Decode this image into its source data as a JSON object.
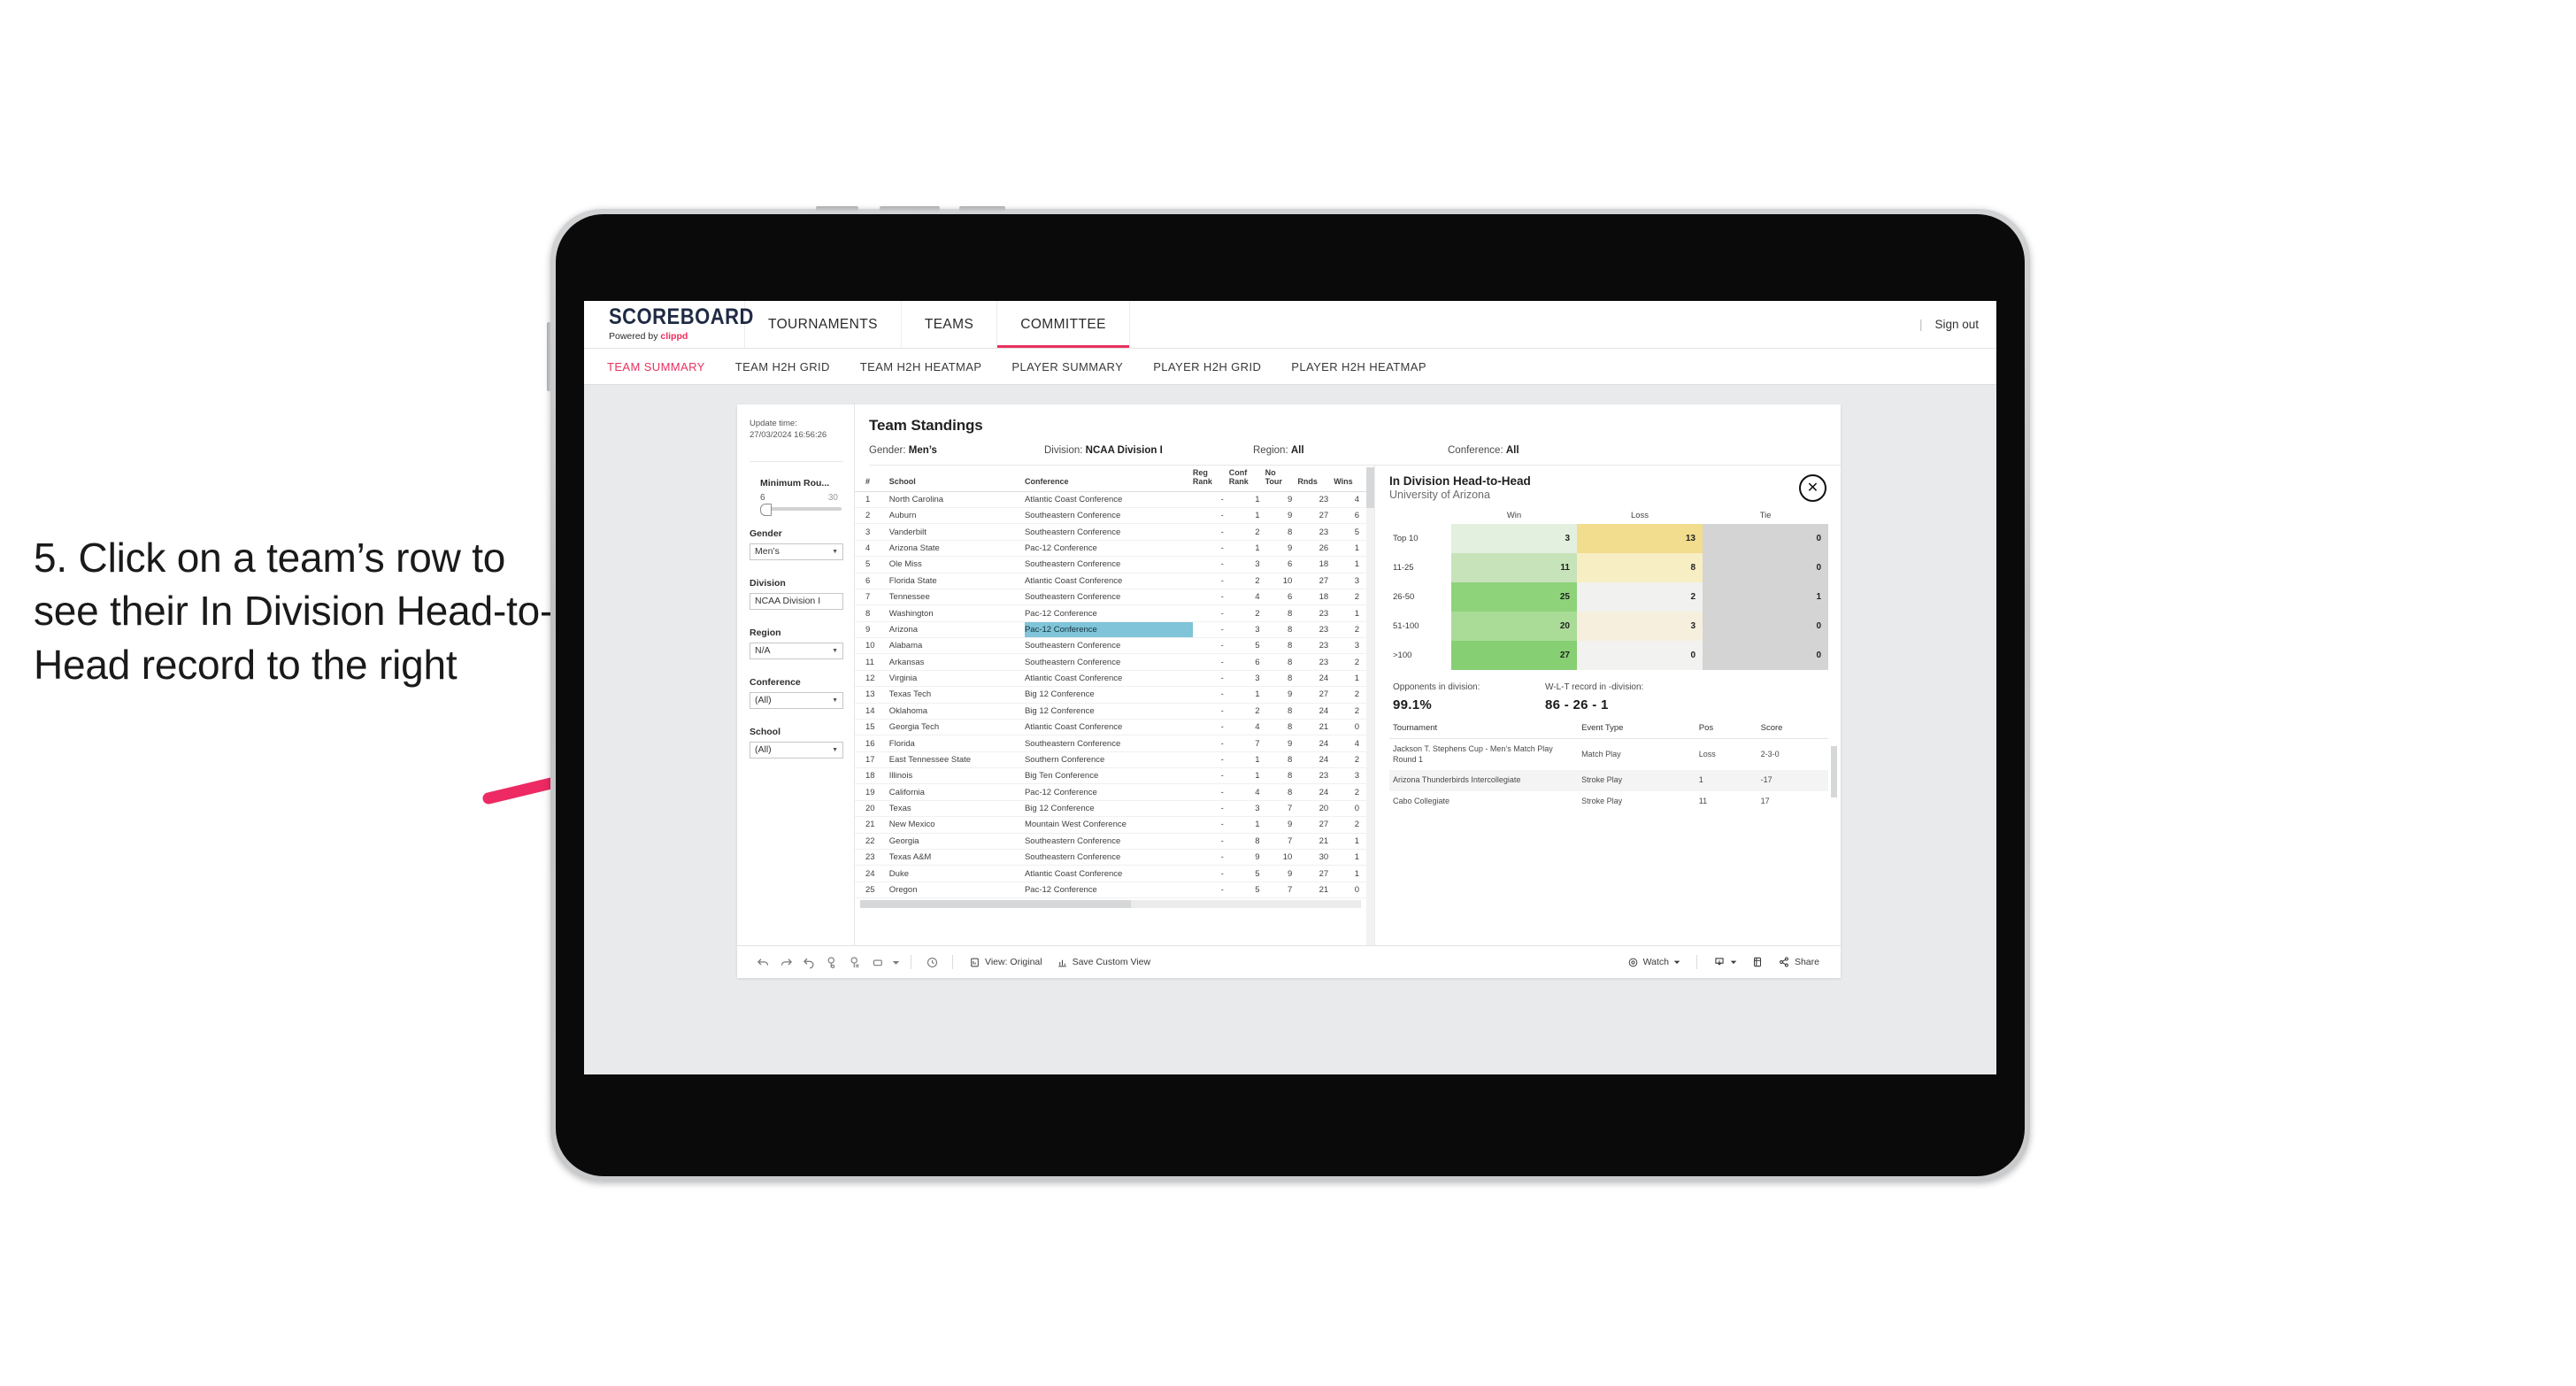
{
  "annotation": {
    "text": "5. Click on a team’s row to see their In Division Head-to-Head record to the right",
    "arrow_color": "#ed2a63"
  },
  "app": {
    "brand": {
      "title": "SCOREBOARD",
      "powered_prefix": "Powered by ",
      "powered_name": "clippd"
    },
    "top_nav": [
      {
        "label": "TOURNAMENTS",
        "active": false
      },
      {
        "label": "TEAMS",
        "active": false
      },
      {
        "label": "COMMITTEE",
        "active": true
      }
    ],
    "sign_out": "Sign out",
    "sub_nav": [
      {
        "label": "TEAM SUMMARY",
        "active": true
      },
      {
        "label": "TEAM H2H GRID",
        "active": false
      },
      {
        "label": "TEAM H2H HEATMAP",
        "active": false
      },
      {
        "label": "PLAYER SUMMARY",
        "active": false
      },
      {
        "label": "PLAYER H2H GRID",
        "active": false
      },
      {
        "label": "PLAYER H2H HEATMAP",
        "active": false
      }
    ]
  },
  "filters": {
    "update_time_label": "Update time:",
    "update_time_value": "27/03/2024 16:56:26",
    "slider": {
      "title": "Minimum Rou...",
      "min": "6",
      "max": "30"
    },
    "gender": {
      "title": "Gender",
      "value": "Men’s"
    },
    "division": {
      "title": "Division",
      "value": "NCAA Division I"
    },
    "region": {
      "title": "Region",
      "value": "N/A"
    },
    "conference": {
      "title": "Conference",
      "value": "(All)"
    },
    "school": {
      "title": "School",
      "value": "(All)"
    }
  },
  "standings": {
    "title": "Team Standings",
    "filter_summary": [
      {
        "label": "Gender:",
        "value": "Men’s"
      },
      {
        "label": "Division:",
        "value": "NCAA Division I"
      },
      {
        "label": "Region:",
        "value": "All"
      },
      {
        "label": "Conference:",
        "value": "All"
      }
    ],
    "columns": [
      "#",
      "School",
      "Conference",
      "Reg Rank",
      "Conf Rank",
      "No Tour",
      "Rnds",
      "Wins"
    ],
    "rows": [
      {
        "n": "1",
        "school": "North Carolina",
        "conf": "Atlantic Coast Conference",
        "reg": "-",
        "cr": "1",
        "nt": "9",
        "rnds": "23",
        "wins": "4"
      },
      {
        "n": "2",
        "school": "Auburn",
        "conf": "Southeastern Conference",
        "reg": "-",
        "cr": "1",
        "nt": "9",
        "rnds": "27",
        "wins": "6"
      },
      {
        "n": "3",
        "school": "Vanderbilt",
        "conf": "Southeastern Conference",
        "reg": "-",
        "cr": "2",
        "nt": "8",
        "rnds": "23",
        "wins": "5"
      },
      {
        "n": "4",
        "school": "Arizona State",
        "conf": "Pac-12 Conference",
        "reg": "-",
        "cr": "1",
        "nt": "9",
        "rnds": "26",
        "wins": "1"
      },
      {
        "n": "5",
        "school": "Ole Miss",
        "conf": "Southeastern Conference",
        "reg": "-",
        "cr": "3",
        "nt": "6",
        "rnds": "18",
        "wins": "1"
      },
      {
        "n": "6",
        "school": "Florida State",
        "conf": "Atlantic Coast Conference",
        "reg": "-",
        "cr": "2",
        "nt": "10",
        "rnds": "27",
        "wins": "3"
      },
      {
        "n": "7",
        "school": "Tennessee",
        "conf": "Southeastern Conference",
        "reg": "-",
        "cr": "4",
        "nt": "6",
        "rnds": "18",
        "wins": "2"
      },
      {
        "n": "8",
        "school": "Washington",
        "conf": "Pac-12 Conference",
        "reg": "-",
        "cr": "2",
        "nt": "8",
        "rnds": "23",
        "wins": "1"
      },
      {
        "n": "9",
        "school": "Arizona",
        "conf": "Pac-12 Conference",
        "reg": "-",
        "cr": "3",
        "nt": "8",
        "rnds": "23",
        "wins": "2",
        "selected": true
      },
      {
        "n": "10",
        "school": "Alabama",
        "conf": "Southeastern Conference",
        "reg": "-",
        "cr": "5",
        "nt": "8",
        "rnds": "23",
        "wins": "3"
      },
      {
        "n": "11",
        "school": "Arkansas",
        "conf": "Southeastern Conference",
        "reg": "-",
        "cr": "6",
        "nt": "8",
        "rnds": "23",
        "wins": "2"
      },
      {
        "n": "12",
        "school": "Virginia",
        "conf": "Atlantic Coast Conference",
        "reg": "-",
        "cr": "3",
        "nt": "8",
        "rnds": "24",
        "wins": "1"
      },
      {
        "n": "13",
        "school": "Texas Tech",
        "conf": "Big 12 Conference",
        "reg": "-",
        "cr": "1",
        "nt": "9",
        "rnds": "27",
        "wins": "2"
      },
      {
        "n": "14",
        "school": "Oklahoma",
        "conf": "Big 12 Conference",
        "reg": "-",
        "cr": "2",
        "nt": "8",
        "rnds": "24",
        "wins": "2"
      },
      {
        "n": "15",
        "school": "Georgia Tech",
        "conf": "Atlantic Coast Conference",
        "reg": "-",
        "cr": "4",
        "nt": "8",
        "rnds": "21",
        "wins": "0"
      },
      {
        "n": "16",
        "school": "Florida",
        "conf": "Southeastern Conference",
        "reg": "-",
        "cr": "7",
        "nt": "9",
        "rnds": "24",
        "wins": "4"
      },
      {
        "n": "17",
        "school": "East Tennessee State",
        "conf": "Southern Conference",
        "reg": "-",
        "cr": "1",
        "nt": "8",
        "rnds": "24",
        "wins": "2"
      },
      {
        "n": "18",
        "school": "Illinois",
        "conf": "Big Ten Conference",
        "reg": "-",
        "cr": "1",
        "nt": "8",
        "rnds": "23",
        "wins": "3"
      },
      {
        "n": "19",
        "school": "California",
        "conf": "Pac-12 Conference",
        "reg": "-",
        "cr": "4",
        "nt": "8",
        "rnds": "24",
        "wins": "2"
      },
      {
        "n": "20",
        "school": "Texas",
        "conf": "Big 12 Conference",
        "reg": "-",
        "cr": "3",
        "nt": "7",
        "rnds": "20",
        "wins": "0"
      },
      {
        "n": "21",
        "school": "New Mexico",
        "conf": "Mountain West Conference",
        "reg": "-",
        "cr": "1",
        "nt": "9",
        "rnds": "27",
        "wins": "2"
      },
      {
        "n": "22",
        "school": "Georgia",
        "conf": "Southeastern Conference",
        "reg": "-",
        "cr": "8",
        "nt": "7",
        "rnds": "21",
        "wins": "1"
      },
      {
        "n": "23",
        "school": "Texas A&M",
        "conf": "Southeastern Conference",
        "reg": "-",
        "cr": "9",
        "nt": "10",
        "rnds": "30",
        "wins": "1"
      },
      {
        "n": "24",
        "school": "Duke",
        "conf": "Atlantic Coast Conference",
        "reg": "-",
        "cr": "5",
        "nt": "9",
        "rnds": "27",
        "wins": "1"
      },
      {
        "n": "25",
        "school": "Oregon",
        "conf": "Pac-12 Conference",
        "reg": "-",
        "cr": "5",
        "nt": "7",
        "rnds": "21",
        "wins": "0"
      }
    ]
  },
  "h2h": {
    "title": "In Division Head-to-Head",
    "subtitle": "University of Arizona",
    "close_icon": "close-icon",
    "columns": [
      "",
      "Win",
      "Loss",
      "Tie"
    ],
    "rows": [
      {
        "label": "Top 10",
        "win": "3",
        "loss": "13",
        "tie": "0",
        "win_color": "#e3efdf",
        "loss_color": "#f2dd8e",
        "tie_color": "#d4d4d4"
      },
      {
        "label": "11-25",
        "win": "11",
        "loss": "8",
        "tie": "0",
        "win_color": "#c6e3b9",
        "loss_color": "#f7eec4",
        "tie_color": "#d4d4d4"
      },
      {
        "label": "26-50",
        "win": "25",
        "loss": "2",
        "tie": "1",
        "win_color": "#8ed27a",
        "loss_color": "#f1f1ef",
        "tie_color": "#d4d4d4"
      },
      {
        "label": "51-100",
        "win": "20",
        "loss": "3",
        "tie": "0",
        "win_color": "#aadb97",
        "loss_color": "#f6efdd",
        "tie_color": "#d4d4d4"
      },
      {
        "label": ">100",
        "win": "27",
        "loss": "0",
        "tie": "0",
        "win_color": "#86cf72",
        "loss_color": "#f2f2f0",
        "tie_color": "#d4d4d4"
      }
    ],
    "stats": [
      {
        "label": "Opponents in division:",
        "value": "99.1%"
      },
      {
        "label": "W-L-T record in -division:",
        "value": "86 - 26 - 1"
      }
    ],
    "tour_columns": [
      "Tournament",
      "Event Type",
      "Pos",
      "Score"
    ],
    "tour_rows": [
      {
        "name": "Jackson T. Stephens Cup - Men’s Match Play Round 1",
        "type": "Match Play",
        "pos": "Loss",
        "score": "2-3-0"
      },
      {
        "name": "Arizona Thunderbirds Intercollegiate",
        "type": "Stroke Play",
        "pos": "1",
        "score": "-17"
      },
      {
        "name": "Cabo Collegiate",
        "type": "Stroke Play",
        "pos": "11",
        "score": "17"
      }
    ]
  },
  "toolbar": {
    "icons": [
      "undo-icon",
      "redo-icon",
      "revert-icon",
      "refresh-icon",
      "pause-icon",
      "rectangle-select-icon",
      "dropdown-caret-icon",
      "clock-icon"
    ],
    "view_label": "View: Original",
    "save_label": "Save Custom View",
    "watch_label": "Watch",
    "share_label": "Share",
    "download_icon": "download-icon",
    "device_icon": "device-layout-icon",
    "share_icon": "share-icon"
  },
  "theme": {
    "accent_pink": "#e8315f",
    "selection_blue": "#7fc4d8",
    "screen_bg": "#e9eaec"
  }
}
